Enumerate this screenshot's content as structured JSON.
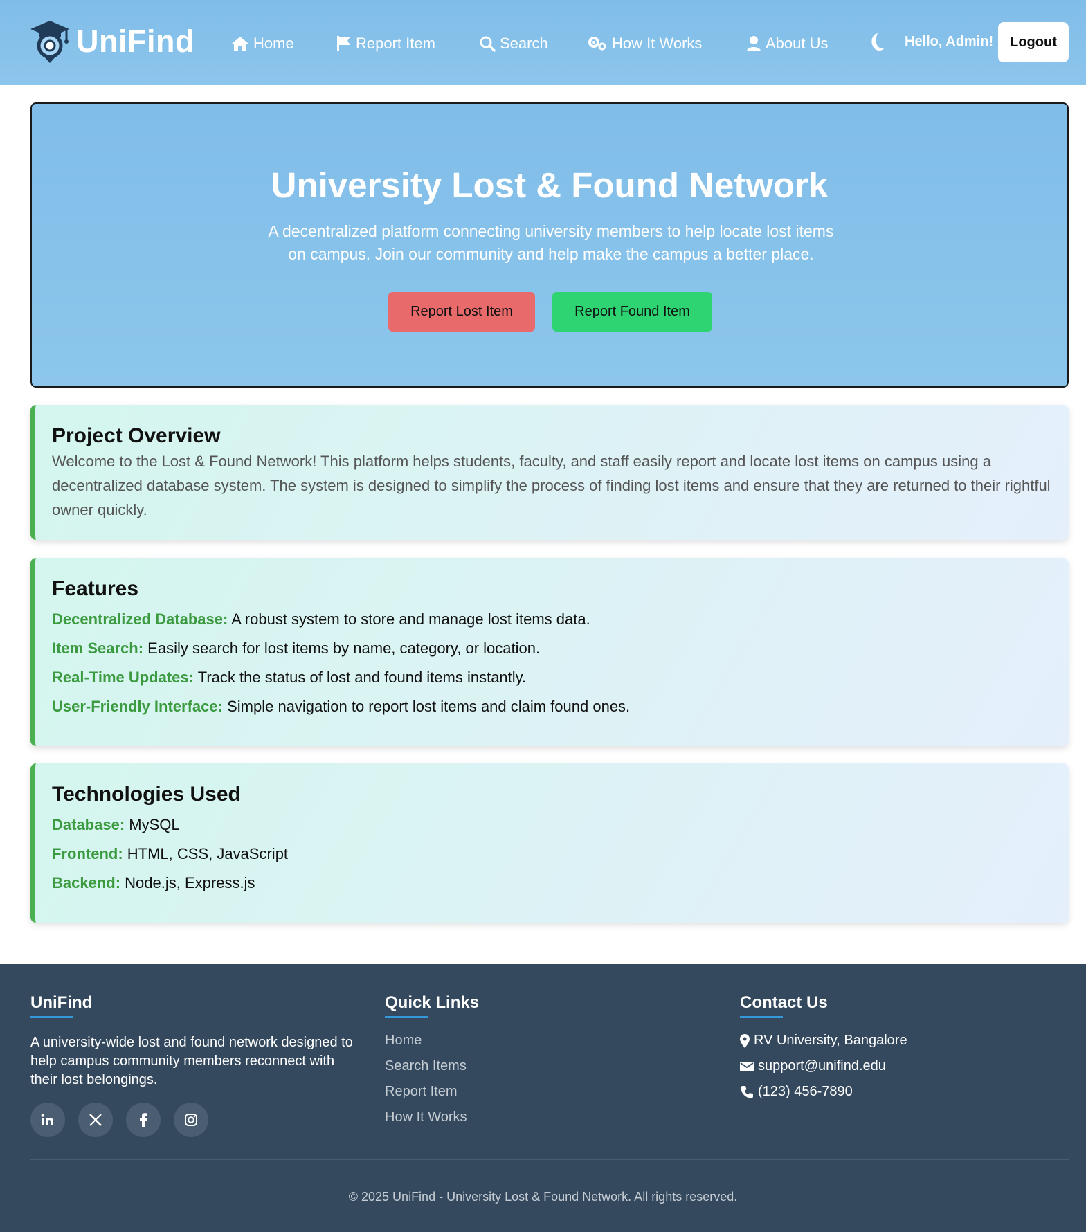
{
  "brand": {
    "name": "UniFind"
  },
  "nav": {
    "items": [
      {
        "label": "Home",
        "icon": "home-icon"
      },
      {
        "label": "Report Item",
        "icon": "flag-icon"
      },
      {
        "label": "Search",
        "icon": "search-icon"
      },
      {
        "label": "How It Works",
        "icon": "gears-icon"
      },
      {
        "label": "About Us",
        "icon": "user-icon"
      }
    ],
    "theme_toggle_icon": "moon-icon",
    "greeting": "Hello, Admin!",
    "logout_label": "Logout"
  },
  "hero": {
    "title": "University Lost & Found Network",
    "subtitle": "A decentralized platform connecting university members to help locate lost items on campus. Join our community and help make the campus a better place.",
    "report_lost_label": "Report Lost Item",
    "report_found_label": "Report Found Item"
  },
  "overview": {
    "title": "Project Overview",
    "text": "Welcome to the Lost & Found Network! This platform helps students, faculty, and staff easily report and locate lost items on campus using a decentralized database system. The system is designed to simplify the process of finding lost items and ensure that they are returned to their rightful owner quickly."
  },
  "features": {
    "title": "Features",
    "items": [
      {
        "name": "Decentralized Database:",
        "desc": " A robust system to store and manage lost items data."
      },
      {
        "name": "Item Search:",
        "desc": " Easily search for lost items by name, category, or location."
      },
      {
        "name": "Real-Time Updates:",
        "desc": " Track the status of lost and found items instantly."
      },
      {
        "name": "User-Friendly Interface:",
        "desc": " Simple navigation to report lost items and claim found ones."
      }
    ]
  },
  "technologies": {
    "title": "Technologies Used",
    "items": [
      {
        "name": "Database:",
        "desc": " MySQL"
      },
      {
        "name": "Frontend:",
        "desc": " HTML, CSS, JavaScript"
      },
      {
        "name": "Backend:",
        "desc": " Node.js, Express.js"
      }
    ]
  },
  "footer": {
    "about": {
      "title": "UniFind",
      "text": "A university-wide lost and found network designed to help campus community members reconnect with their lost belongings.",
      "socials": [
        "linkedin-icon",
        "x-icon",
        "facebook-icon",
        "instagram-icon"
      ]
    },
    "quick_links": {
      "title": "Quick Links",
      "items": [
        "Home",
        "Search Items",
        "Report Item",
        "How It Works"
      ]
    },
    "contact": {
      "title": "Contact Us",
      "address": "RV University, Bangalore",
      "email": "support@unifind.edu",
      "phone": "(123) 456-7890"
    },
    "copyright": "© 2025 UniFind - University Lost & Found Network. All rights reserved."
  },
  "colors": {
    "header_bg": "#80bde8",
    "report_lost": "#e86a6a",
    "report_found": "#2ed472",
    "accent_green": "#3c9a40",
    "footer_bg": "#34495e",
    "footer_underline": "#3498db"
  }
}
